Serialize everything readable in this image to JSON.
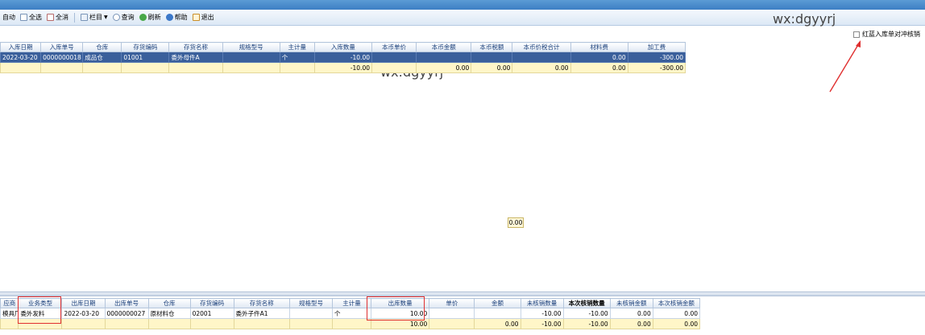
{
  "toolbar": {
    "auto_label": "自动",
    "select_all_label": "全选",
    "deselect_all_label": "全消",
    "columns_label": "栏目",
    "query_label": "查询",
    "refresh_label": "刷新",
    "help_label": "帮助",
    "exit_label": "退出"
  },
  "watermark": "wx:dgyyrj",
  "red_blue_label": "红蓝入库单对冲核销",
  "middle_value": "0.00",
  "top_grid": {
    "headers": [
      "入库日期",
      "入库单号",
      "仓库",
      "存货编码",
      "存货名称",
      "规格型号",
      "主计量",
      "入库数量",
      "本币单价",
      "本币金额",
      "本币税额",
      "本币价税合计",
      "材料费",
      "加工费"
    ],
    "rows": [
      [
        "2022-03-20",
        "0000000018",
        "成品仓",
        "01001",
        "委外母件A",
        "",
        "个",
        "-10.00",
        "",
        "",
        "",
        "",
        "0.00",
        "-300.00"
      ]
    ],
    "total": [
      "",
      "",
      "",
      "",
      "",
      "",
      "",
      "-10.00",
      "",
      "0.00",
      "0.00",
      "0.00",
      "0.00",
      "-300.00"
    ]
  },
  "bottom_grid": {
    "headers": [
      "应商",
      "业务类型",
      "出库日期",
      "出库单号",
      "仓库",
      "存货编码",
      "存货名称",
      "规格型号",
      "主计量",
      "出库数量",
      "单价",
      "金额",
      "未核销数量",
      "本次核销数量",
      "未核销金额",
      "本次核销金额"
    ],
    "rows": [
      [
        "模具厂",
        "委外发料",
        "2022-03-20",
        "0000000027",
        "原材料仓",
        "02001",
        "委外子件A1",
        "",
        "个",
        "10.00",
        "",
        "",
        "-10.00",
        "-10.00",
        "0.00",
        "0.00"
      ]
    ],
    "total": [
      "",
      "",
      "",
      "",
      "",
      "",
      "",
      "",
      "",
      "10.00",
      "",
      "0.00",
      "-10.00",
      "-10.00",
      "0.00",
      "0.00"
    ]
  }
}
